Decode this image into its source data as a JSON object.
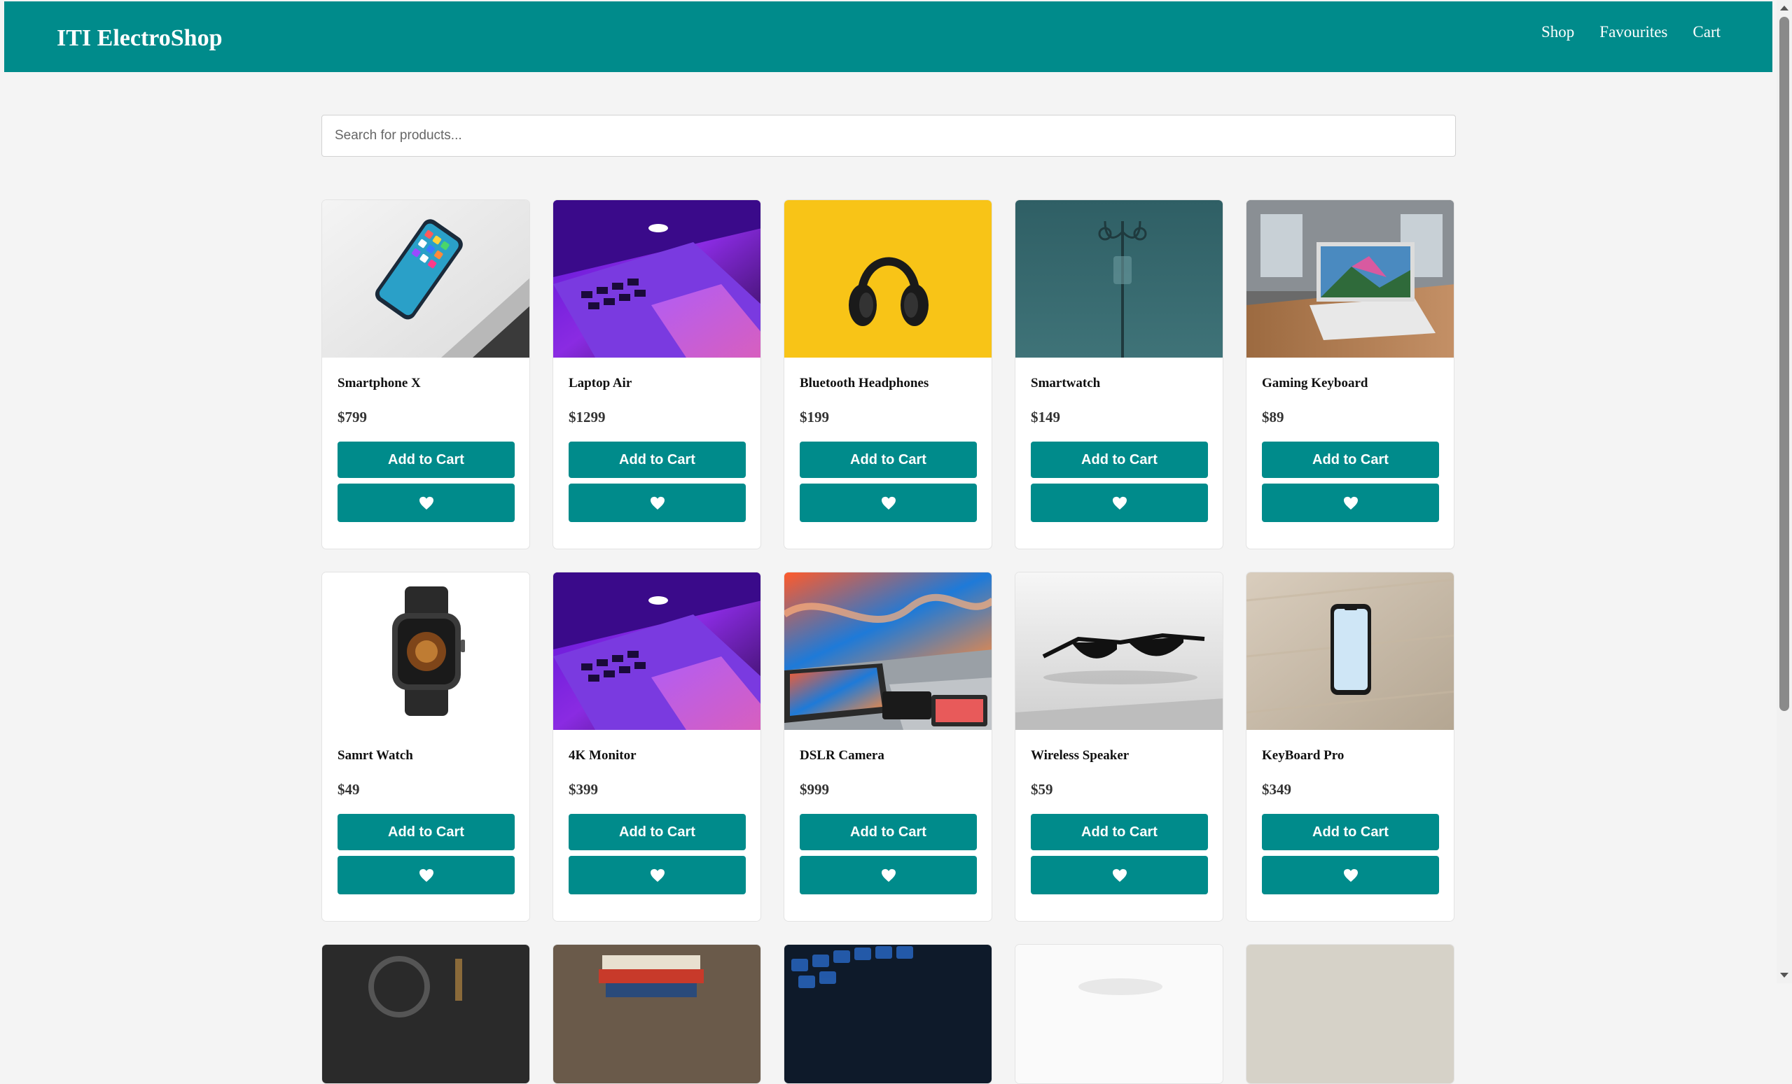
{
  "navbar": {
    "brand": "ITI ElectroShop",
    "links": [
      "Shop",
      "Favourites",
      "Cart"
    ]
  },
  "search": {
    "placeholder": "Search for products..."
  },
  "buttons": {
    "add_to_cart": "Add to Cart"
  },
  "icons": {
    "favourite": "heart-icon"
  },
  "colors": {
    "accent": "#008b8b",
    "background": "#f4f4f4",
    "card": "#ffffff"
  },
  "products": [
    {
      "name": "Smartphone X",
      "price": "$799",
      "image": "smartphone-image"
    },
    {
      "name": "Laptop Air",
      "price": "$1299",
      "image": "laptop-image"
    },
    {
      "name": "Bluetooth Headphones",
      "price": "$199",
      "image": "headphones-image"
    },
    {
      "name": "Smartwatch",
      "price": "$149",
      "image": "iv-stand-image"
    },
    {
      "name": "Gaming Keyboard",
      "price": "$89",
      "image": "laptop-desk-image"
    },
    {
      "name": "Samrt Watch",
      "price": "$49",
      "image": "smartwatch-image"
    },
    {
      "name": "4K Monitor",
      "price": "$399",
      "image": "laptop-image"
    },
    {
      "name": "DSLR Camera",
      "price": "$999",
      "image": "devices-image"
    },
    {
      "name": "Wireless Speaker",
      "price": "$59",
      "image": "sunglasses-image"
    },
    {
      "name": "KeyBoard Pro",
      "price": "$349",
      "image": "phone-on-wood-image"
    }
  ]
}
